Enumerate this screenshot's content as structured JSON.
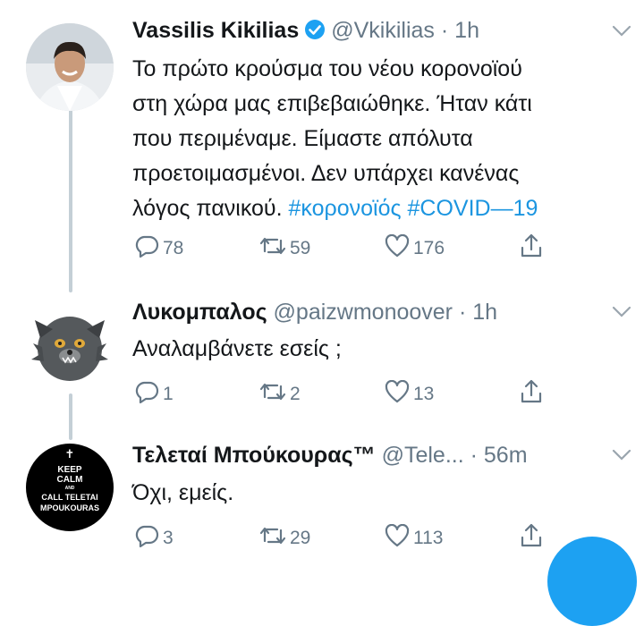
{
  "tweets": [
    {
      "name": "Vassilis Kikilias",
      "handle": "@Vkikilias",
      "time": "· 1h",
      "verified": true,
      "text_lines": [
        "Το πρώτο κρούσμα του νέου κορονοϊού",
        "στη χώρα μας επιβεβαιώθηκε. Ήταν κάτι",
        "που περιμέναμε. Είμαστε απόλυτα",
        "προετοιμασμένοι. Δεν υπάρχει κανένας"
      ],
      "last_line_text": "λόγος πανικού.",
      "hashtags": [
        "#κορονοϊός",
        "#COVID—19"
      ],
      "replies": "78",
      "retweets": "59",
      "likes": "176"
    },
    {
      "name": "Λυκομπαλος",
      "handle": "@paizwmonoover",
      "time": "· 1h",
      "text": "Αναλαμβάνετε εσείς ;",
      "replies": "1",
      "retweets": "2",
      "likes": "13"
    },
    {
      "name": "Τελεταί Μπούκουρας™",
      "handle": "@Tele...",
      "time": "· 56m",
      "text": "Όχι, εμείς.",
      "replies": "3",
      "retweets": "29",
      "likes": "113",
      "avatar_text": [
        "KEEP",
        "CALM",
        "AND",
        "CALL TELETAI",
        "MPOUKOURAS"
      ]
    }
  ],
  "colors": {
    "link": "#1b95e0",
    "muted": "#657786",
    "thread": "#c4cfd6",
    "accent": "#1da1f2"
  },
  "icons": [
    "reply-icon",
    "retweet-icon",
    "like-icon",
    "share-icon",
    "verified-badge-icon",
    "chevron-down-icon",
    "cross-icon"
  ]
}
